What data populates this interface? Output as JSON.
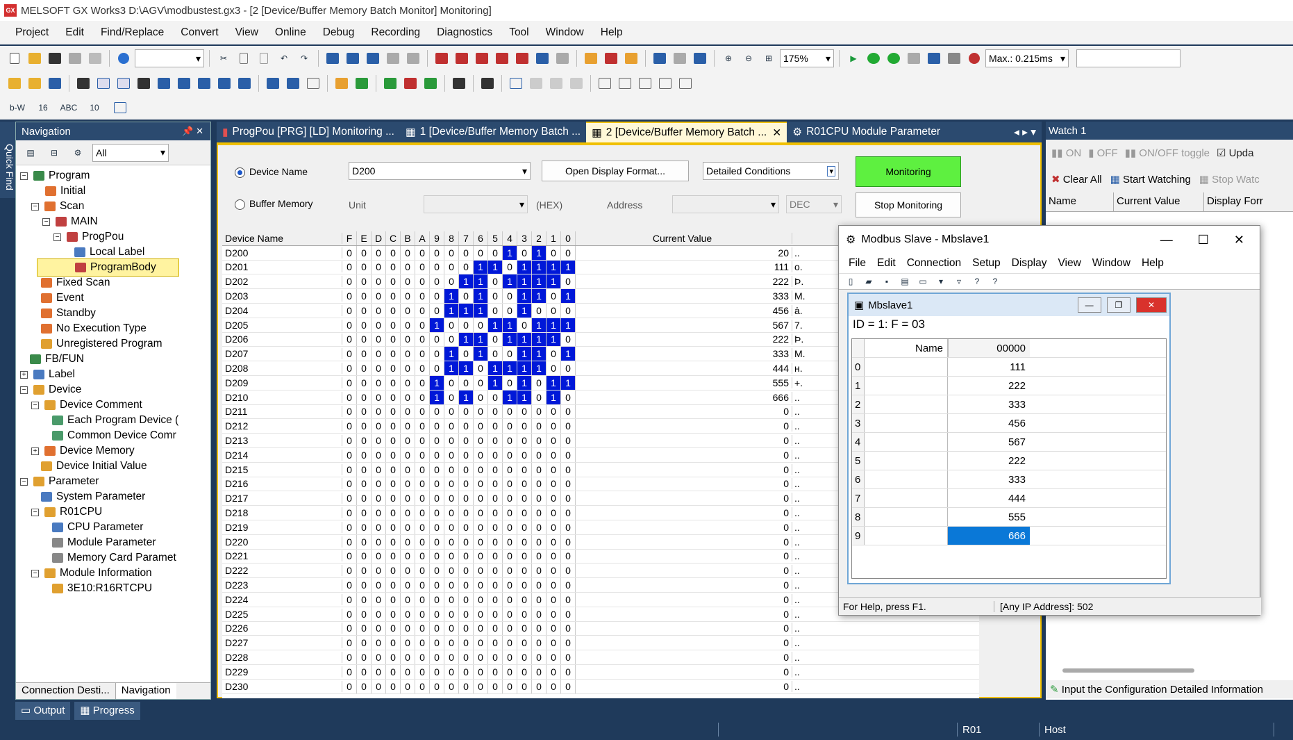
{
  "app": {
    "title": "MELSOFT GX Works3 D:\\AGV\\modbustest.gx3 - [2 [Device/Buffer Memory Batch Monitor] Monitoring]"
  },
  "menu": [
    "Project",
    "Edit",
    "Find/Replace",
    "Convert",
    "View",
    "Online",
    "Debug",
    "Recording",
    "Diagnostics",
    "Tool",
    "Window",
    "Help"
  ],
  "toolbar": {
    "zoom": "175%",
    "scan_time": "Max.: 0.215ms"
  },
  "quick_find": "Quick Find",
  "navigation": {
    "title": "Navigation",
    "filter": "All",
    "items": [
      "Program",
      "Initial",
      "Scan",
      "MAIN",
      "ProgPou",
      "Local Label",
      "ProgramBody",
      "Fixed Scan",
      "Event",
      "Standby",
      "No Execution Type",
      "Unregistered Program",
      "FB/FUN",
      "Label",
      "Device",
      "Device Comment",
      "Each Program Device (",
      "Common Device Comr",
      "Device Memory",
      "Device Initial Value",
      "Parameter",
      "System Parameter",
      "R01CPU",
      "CPU Parameter",
      "Module Parameter",
      "Memory Card Paramet",
      "Module Information",
      "3E10:R16RTCPU"
    ],
    "bottom_tabs": [
      "Connection Desti...",
      "Navigation"
    ]
  },
  "tabs": [
    "ProgPou [PRG] [LD] Monitoring ...",
    "1 [Device/Buffer Memory Batch ...",
    "2 [Device/Buffer Memory Batch ...",
    "R01CPU Module Parameter"
  ],
  "monitor": {
    "device_name_label": "Device Name",
    "device_name_value": "D200",
    "buffer_memory_label": "Buffer Memory",
    "unit_label": "Unit",
    "hex_label": "(HEX)",
    "address_label": "Address",
    "dec_label": "DEC",
    "open_display_format": "Open Display Format...",
    "detailed_conditions": "Detailed Conditions",
    "monitoring_btn": "Monitoring",
    "stop_monitoring_btn": "Stop Monitoring",
    "columns": {
      "device": "Device Name",
      "bits": [
        "F",
        "E",
        "D",
        "C",
        "B",
        "A",
        "9",
        "8",
        "7",
        "6",
        "5",
        "4",
        "3",
        "2",
        "1",
        "0"
      ],
      "value": "Current Value"
    },
    "rows": [
      {
        "name": "D200",
        "value": "20",
        "chr": ".."
      },
      {
        "name": "D201",
        "value": "111",
        "chr": "o."
      },
      {
        "name": "D202",
        "value": "222",
        "chr": "Þ."
      },
      {
        "name": "D203",
        "value": "333",
        "chr": "M."
      },
      {
        "name": "D204",
        "value": "456",
        "chr": "ȧ."
      },
      {
        "name": "D205",
        "value": "567",
        "chr": "7."
      },
      {
        "name": "D206",
        "value": "222",
        "chr": "Þ."
      },
      {
        "name": "D207",
        "value": "333",
        "chr": "M."
      },
      {
        "name": "D208",
        "value": "444",
        "chr": "ʜ."
      },
      {
        "name": "D209",
        "value": "555",
        "chr": "+."
      },
      {
        "name": "D210",
        "value": "666",
        "chr": ".."
      },
      {
        "name": "D211",
        "value": "0",
        "chr": ".."
      },
      {
        "name": "D212",
        "value": "0",
        "chr": ".."
      },
      {
        "name": "D213",
        "value": "0",
        "chr": ".."
      },
      {
        "name": "D214",
        "value": "0",
        "chr": ".."
      },
      {
        "name": "D215",
        "value": "0",
        "chr": ".."
      },
      {
        "name": "D216",
        "value": "0",
        "chr": ".."
      },
      {
        "name": "D217",
        "value": "0",
        "chr": ".."
      },
      {
        "name": "D218",
        "value": "0",
        "chr": ".."
      },
      {
        "name": "D219",
        "value": "0",
        "chr": ".."
      },
      {
        "name": "D220",
        "value": "0",
        "chr": ".."
      },
      {
        "name": "D221",
        "value": "0",
        "chr": ".."
      },
      {
        "name": "D222",
        "value": "0",
        "chr": ".."
      },
      {
        "name": "D223",
        "value": "0",
        "chr": ".."
      },
      {
        "name": "D224",
        "value": "0",
        "chr": ".."
      },
      {
        "name": "D225",
        "value": "0",
        "chr": ".."
      },
      {
        "name": "D226",
        "value": "0",
        "chr": ".."
      },
      {
        "name": "D227",
        "value": "0",
        "chr": ".."
      },
      {
        "name": "D228",
        "value": "0",
        "chr": ".."
      },
      {
        "name": "D229",
        "value": "0",
        "chr": ".."
      },
      {
        "name": "D230",
        "value": "0",
        "chr": ".."
      }
    ]
  },
  "watch": {
    "title": "Watch 1",
    "on": "ON",
    "off": "OFF",
    "toggle": "ON/OFF toggle",
    "update": "Upda",
    "clear_all": "Clear All",
    "start_watching": "Start Watching",
    "stop_watching": "Stop Watc",
    "columns": [
      "Name",
      "Current Value",
      "Display Forr"
    ],
    "info": "Input the Configuration Detailed Information"
  },
  "modbus": {
    "title": "Modbus Slave - Mbslave1",
    "menu": [
      "File",
      "Edit",
      "Connection",
      "Setup",
      "Display",
      "View",
      "Window",
      "Help"
    ],
    "child_title": "Mbslave1",
    "id_line": "ID = 1: F = 03",
    "name_col": "Name",
    "addr_col": "00000",
    "rows": [
      {
        "i": "0",
        "v": "111"
      },
      {
        "i": "1",
        "v": "222"
      },
      {
        "i": "2",
        "v": "333"
      },
      {
        "i": "3",
        "v": "456"
      },
      {
        "i": "4",
        "v": "567"
      },
      {
        "i": "5",
        "v": "222"
      },
      {
        "i": "6",
        "v": "333"
      },
      {
        "i": "7",
        "v": "444"
      },
      {
        "i": "8",
        "v": "555"
      },
      {
        "i": "9",
        "v": "666"
      }
    ],
    "status_help": "For Help, press F1.",
    "status_addr": "[Any IP Address]: 502"
  },
  "bottom": {
    "output": "Output",
    "progress": "Progress",
    "cpu": "R01",
    "host": "Host"
  }
}
